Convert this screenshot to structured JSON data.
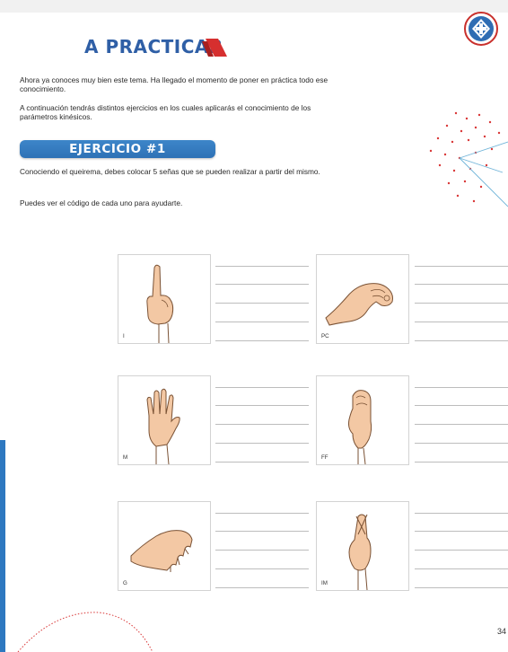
{
  "header": {
    "title": "A PRACTICAR"
  },
  "intro": {
    "p1": "Ahora ya conoces muy bien este tema. Ha llegado el momento de poner en práctica todo ese conocimiento.",
    "p2": "A continuación tendrás distintos ejercicios en los cuales aplicarás el conocimiento de los parámetros kinésicos."
  },
  "exercise": {
    "label": "EJERCICIO #1",
    "instruction": "Conociendo el queirema, debes colocar 5 señas que se pueden realizar a partir del mismo.",
    "hint": "Puedes ver el código de cada uno para ayudarte."
  },
  "cards": [
    {
      "code": "I",
      "hand": "index-finger-up"
    },
    {
      "code": "PC",
      "hand": "pinched-fingers"
    },
    {
      "code": "M",
      "hand": "open-palm"
    },
    {
      "code": "FF",
      "hand": "closed-fingers-side"
    },
    {
      "code": "G",
      "hand": "claw-hand"
    },
    {
      "code": "IM",
      "hand": "crossed-fingers"
    }
  ],
  "page_number": "34",
  "colors": {
    "title": "#2f5fa6",
    "accent_red": "#d62f2f",
    "exercise_bar": "#2e72b6",
    "edge_bar": "#2e78c0"
  }
}
